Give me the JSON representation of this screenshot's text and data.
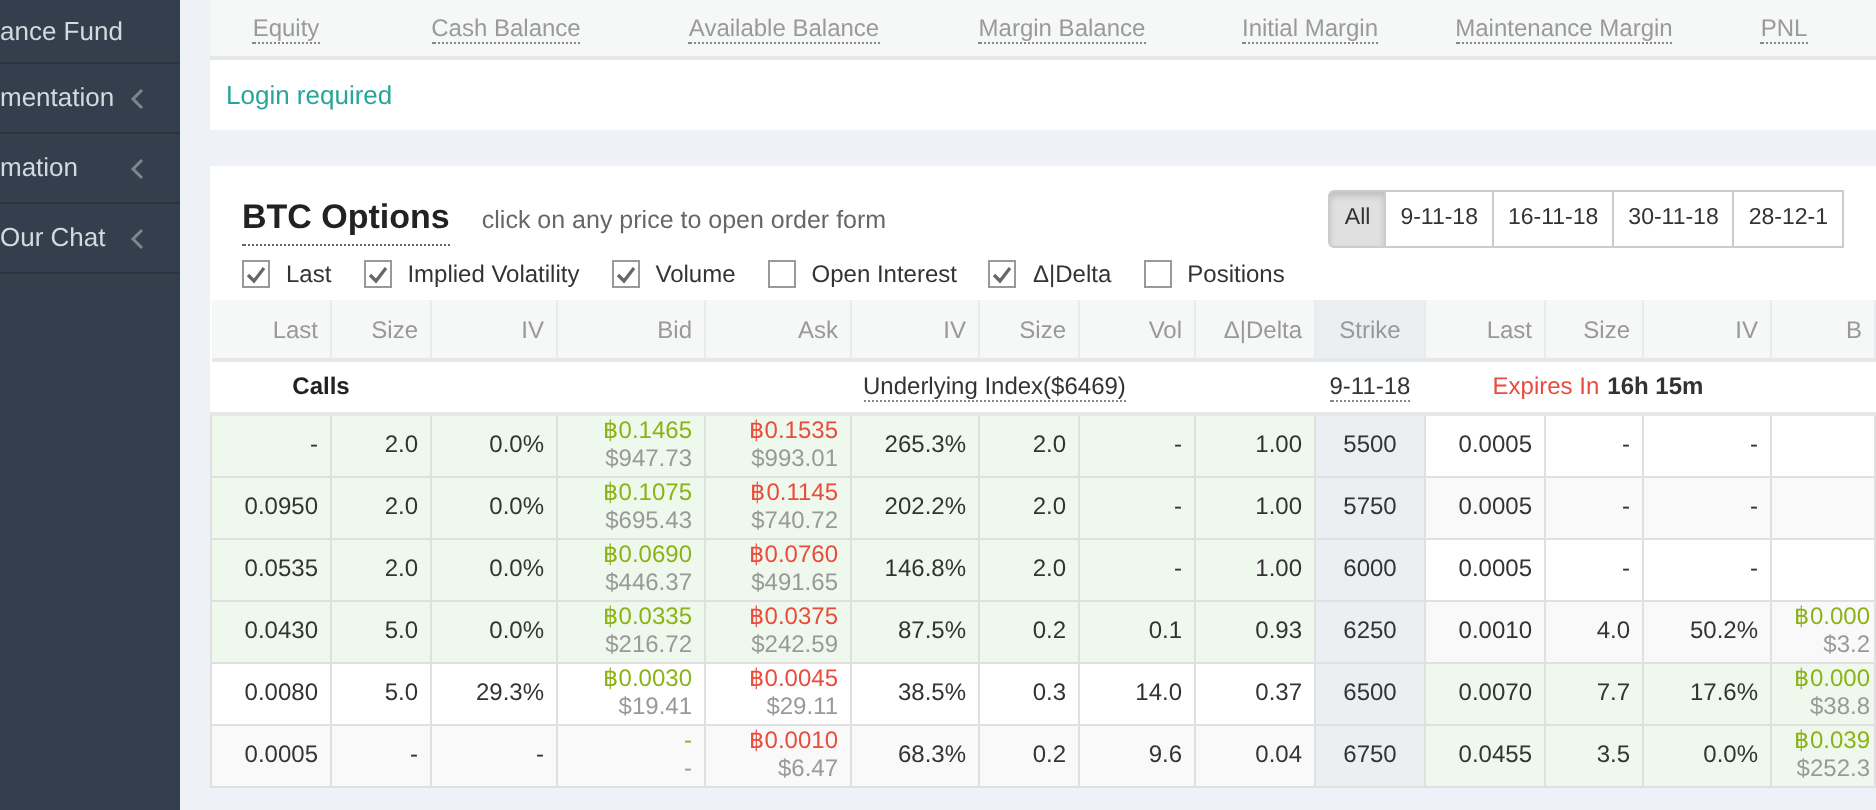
{
  "sidebar": {
    "items": [
      {
        "label": "ance Fund",
        "has_chevron": false
      },
      {
        "label": "mentation",
        "has_chevron": true
      },
      {
        "label": "mation",
        "has_chevron": true
      },
      {
        "label": "Our Chat",
        "has_chevron": true
      }
    ]
  },
  "account": {
    "columns": [
      "Equity",
      "Cash Balance",
      "Available Balance",
      "Margin Balance",
      "Initial Margin",
      "Maintenance Margin",
      "PNL"
    ],
    "message": "Login required"
  },
  "options": {
    "title": "BTC Options",
    "hint": "click on any price to open order form",
    "expiry_filters": [
      {
        "label": "All",
        "selected": true
      },
      {
        "label": "9-11-18",
        "selected": false
      },
      {
        "label": "16-11-18",
        "selected": false
      },
      {
        "label": "30-11-18",
        "selected": false
      },
      {
        "label": "28-12-1",
        "selected": false
      }
    ],
    "toggles": [
      {
        "label": "Last",
        "checked": true
      },
      {
        "label": "Implied Volatility",
        "checked": true
      },
      {
        "label": "Volume",
        "checked": true
      },
      {
        "label": "Open Interest",
        "checked": false
      },
      {
        "label": "Δ|Delta",
        "checked": true
      },
      {
        "label": "Positions",
        "checked": false
      }
    ],
    "table": {
      "columns": [
        {
          "label": "Last",
          "kind": "text"
        },
        {
          "label": "Size",
          "kind": "text"
        },
        {
          "label": "IV",
          "kind": "text"
        },
        {
          "label": "Bid",
          "kind": "bid"
        },
        {
          "label": "Ask",
          "kind": "ask"
        },
        {
          "label": "IV",
          "kind": "text"
        },
        {
          "label": "Size",
          "kind": "text"
        },
        {
          "label": "Vol",
          "kind": "text"
        },
        {
          "label": "Δ|Delta",
          "kind": "text"
        },
        {
          "label": "Strike",
          "kind": "strike"
        },
        {
          "label": "Last",
          "kind": "text"
        },
        {
          "label": "Size",
          "kind": "text"
        },
        {
          "label": "IV",
          "kind": "text"
        },
        {
          "label": "B",
          "kind": "bid"
        }
      ],
      "info_row": {
        "calls_label": "Calls",
        "underlying": "Underlying Index($6469)",
        "expiry": "9-11-18",
        "expires_label": "Expires In",
        "expires_value": "16h 15m"
      },
      "rows": [
        {
          "call_itm": true,
          "put_itm": false,
          "cells": [
            "-",
            "2.0",
            "0.0%",
            [
              "฿0.1465",
              "$947.73"
            ],
            [
              "฿0.1535",
              "$993.01"
            ],
            "265.3%",
            "2.0",
            "-",
            "1.00",
            "5500",
            "0.0005",
            "-",
            "-",
            []
          ]
        },
        {
          "call_itm": true,
          "put_itm": false,
          "cells": [
            "0.0950",
            "2.0",
            "0.0%",
            [
              "฿0.1075",
              "$695.43"
            ],
            [
              "฿0.1145",
              "$740.72"
            ],
            "202.2%",
            "2.0",
            "-",
            "1.00",
            "5750",
            "0.0005",
            "-",
            "-",
            []
          ]
        },
        {
          "call_itm": true,
          "put_itm": false,
          "cells": [
            "0.0535",
            "2.0",
            "0.0%",
            [
              "฿0.0690",
              "$446.37"
            ],
            [
              "฿0.0760",
              "$491.65"
            ],
            "146.8%",
            "2.0",
            "-",
            "1.00",
            "6000",
            "0.0005",
            "-",
            "-",
            []
          ]
        },
        {
          "call_itm": true,
          "put_itm": false,
          "cells": [
            "0.0430",
            "5.0",
            "0.0%",
            [
              "฿0.0335",
              "$216.72"
            ],
            [
              "฿0.0375",
              "$242.59"
            ],
            "87.5%",
            "0.2",
            "0.1",
            "0.93",
            "6250",
            "0.0010",
            "4.0",
            "50.2%",
            [
              "฿0.000",
              "$3.2"
            ]
          ]
        },
        {
          "call_itm": false,
          "put_itm": true,
          "cells": [
            "0.0080",
            "5.0",
            "29.3%",
            [
              "฿0.0030",
              "$19.41"
            ],
            [
              "฿0.0045",
              "$29.11"
            ],
            "38.5%",
            "0.3",
            "14.0",
            "0.37",
            "6500",
            "0.0070",
            "7.7",
            "17.6%",
            [
              "฿0.000",
              "$38.8"
            ]
          ]
        },
        {
          "call_itm": false,
          "put_itm": true,
          "cells": [
            "0.0005",
            "-",
            "-",
            [
              "-",
              "-"
            ],
            [
              "฿0.0010",
              "$6.47"
            ],
            "68.3%",
            "0.2",
            "9.6",
            "0.04",
            "6750",
            "0.0455",
            "3.5",
            "0.0%",
            [
              "฿0.039",
              "$252.3"
            ]
          ]
        }
      ]
    }
  }
}
